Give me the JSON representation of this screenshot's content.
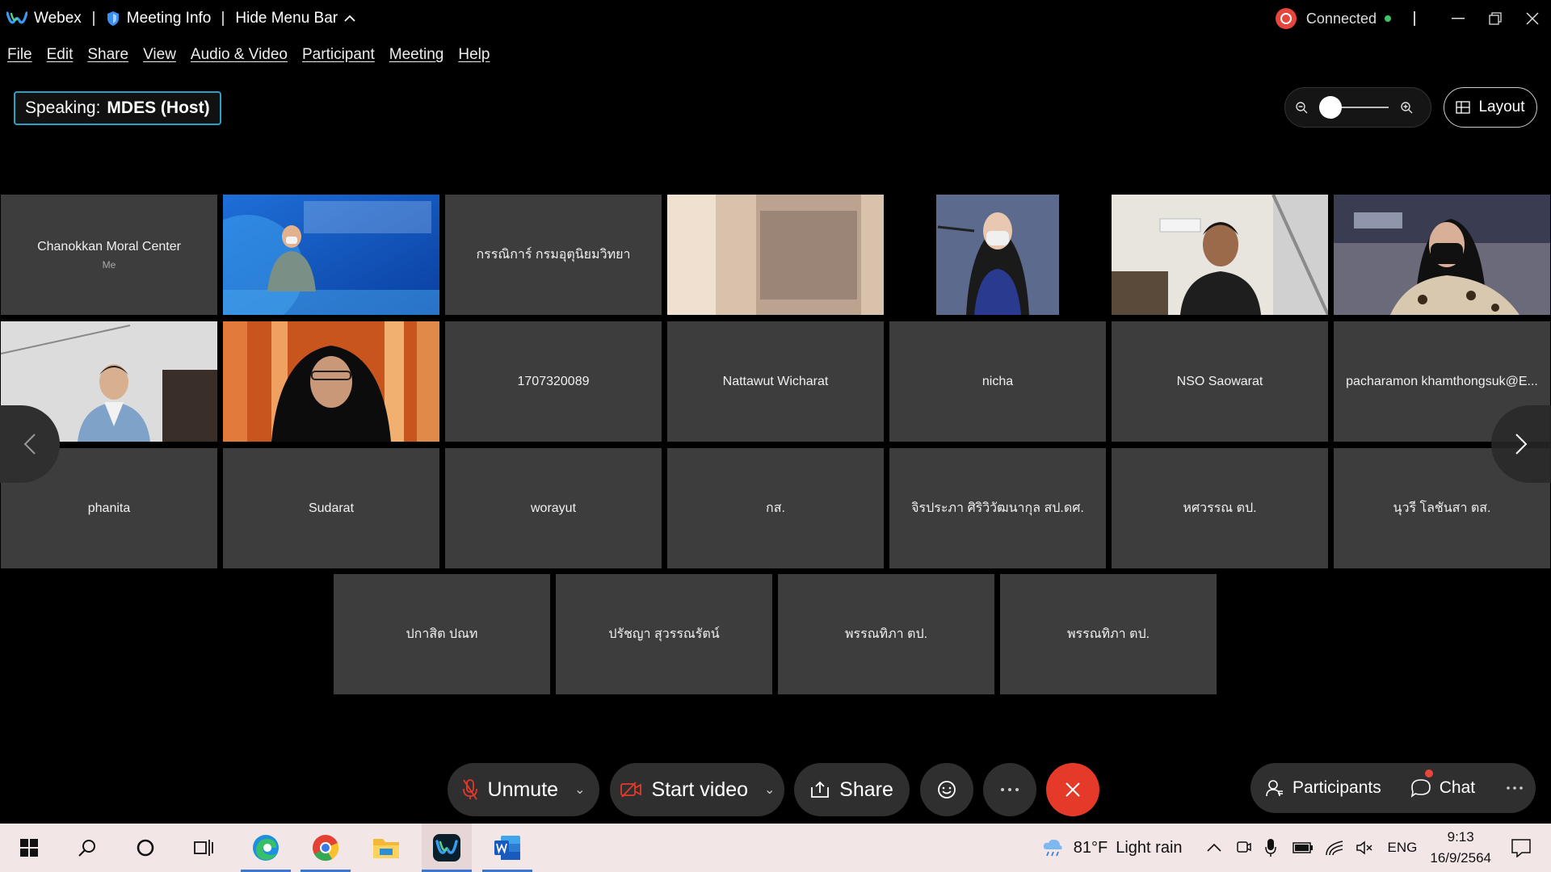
{
  "titlebar": {
    "app_name": "Webex",
    "meeting_info": "Meeting Info",
    "hide_menu": "Hide Menu Bar",
    "connection": "Connected"
  },
  "menu": [
    "File",
    "Edit",
    "Share",
    "View",
    "Audio & Video",
    "Participant",
    "Meeting",
    "Help"
  ],
  "speaking": {
    "label": "Speaking:",
    "name": "MDES (Host)"
  },
  "layout_label": "Layout",
  "tiles": [
    {
      "name": "Chanokkan Moral Center",
      "sub": "Me",
      "video": false
    },
    {
      "name": "",
      "video": true,
      "scene": "slide"
    },
    {
      "name": "กรรณิการ์ กรมอุตุนิยมวิทยา",
      "video": false
    },
    {
      "name": "",
      "video": true,
      "scene": "room"
    },
    {
      "name": "",
      "video": true,
      "scene": "woman-dark"
    },
    {
      "name": "",
      "video": true,
      "scene": "man-room"
    },
    {
      "name": "",
      "video": true,
      "scene": "woman-mask"
    },
    {
      "name": "",
      "video": true,
      "scene": "man-desk"
    },
    {
      "name": "",
      "video": true,
      "scene": "woman-hijab"
    },
    {
      "name": "1707320089",
      "video": false
    },
    {
      "name": "Nattawut Wicharat",
      "video": false
    },
    {
      "name": "nicha",
      "video": false
    },
    {
      "name": "NSO Saowarat",
      "video": false
    },
    {
      "name": "pacharamon khamthongsuk@E...",
      "video": false
    },
    {
      "name": "phanita",
      "video": false
    },
    {
      "name": "Sudarat",
      "video": false
    },
    {
      "name": "worayut",
      "video": false
    },
    {
      "name": "กส.",
      "video": false
    },
    {
      "name": "จิรประภา ศิริวิวัฒนากุล สป.ดศ.",
      "video": false
    },
    {
      "name": "หศวรรณ ตป.",
      "video": false
    },
    {
      "name": "นุวรี โลชันสา ตส.",
      "video": false
    },
    {
      "name": "ปกาสิต ปณท",
      "video": false
    },
    {
      "name": "ปรัชญา สุวรรณรัตน์",
      "video": false
    },
    {
      "name": "พรรณทิภา ตป.",
      "video": false
    },
    {
      "name": "พรรณทิภา ตป.",
      "video": false
    }
  ],
  "controls": {
    "unmute": "Unmute",
    "start_video": "Start video",
    "share": "Share",
    "participants": "Participants",
    "chat": "Chat"
  },
  "taskbar": {
    "weather_temp": "81°F",
    "weather_desc": "Light rain",
    "lang": "ENG",
    "time": "9:13",
    "date": "16/9/2564"
  },
  "colors": {
    "accent": "#2aa0c8",
    "end_call": "#e5392a",
    "tile_bg": "#3d3d3d"
  }
}
